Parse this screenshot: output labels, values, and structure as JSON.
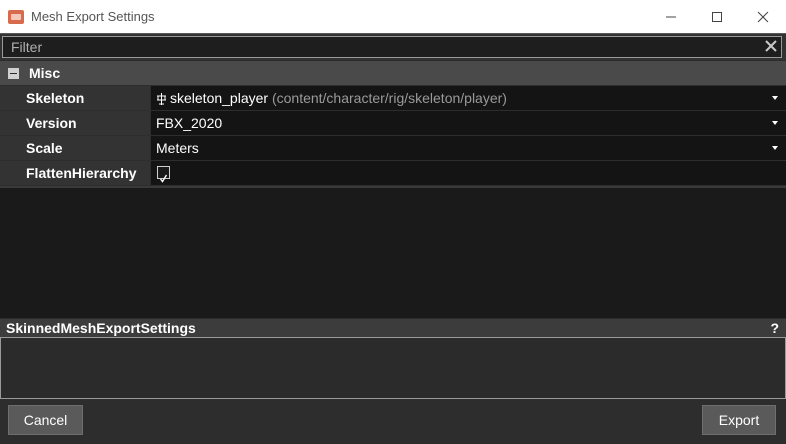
{
  "window": {
    "title": "Mesh Export Settings",
    "icons": [
      "app-icon",
      "minimize-icon",
      "maximize-icon",
      "close-icon"
    ]
  },
  "filter": {
    "placeholder": "Filter",
    "value": "",
    "clear_icon": "clear-x-icon"
  },
  "category": {
    "label": "Misc",
    "expanded": true
  },
  "properties": {
    "skeleton": {
      "label": "Skeleton",
      "value": "skeleton_player",
      "path": "(content/character/rig/skeleton/player)",
      "icon": "skeleton-icon"
    },
    "version": {
      "label": "Version",
      "value": "FBX_2020"
    },
    "scale": {
      "label": "Scale",
      "value": "Meters"
    },
    "flatten": {
      "label": "FlattenHierarchy",
      "checked": true
    }
  },
  "help": {
    "title": "SkinnedMeshExportSettings",
    "icon_label": "?",
    "text": ""
  },
  "buttons": {
    "cancel": "Cancel",
    "export": "Export"
  },
  "colors": {
    "background": "#2d2d2d",
    "category_header": "#4a4a4a",
    "value_cell": "#141414",
    "button": "#5a5a5a"
  }
}
